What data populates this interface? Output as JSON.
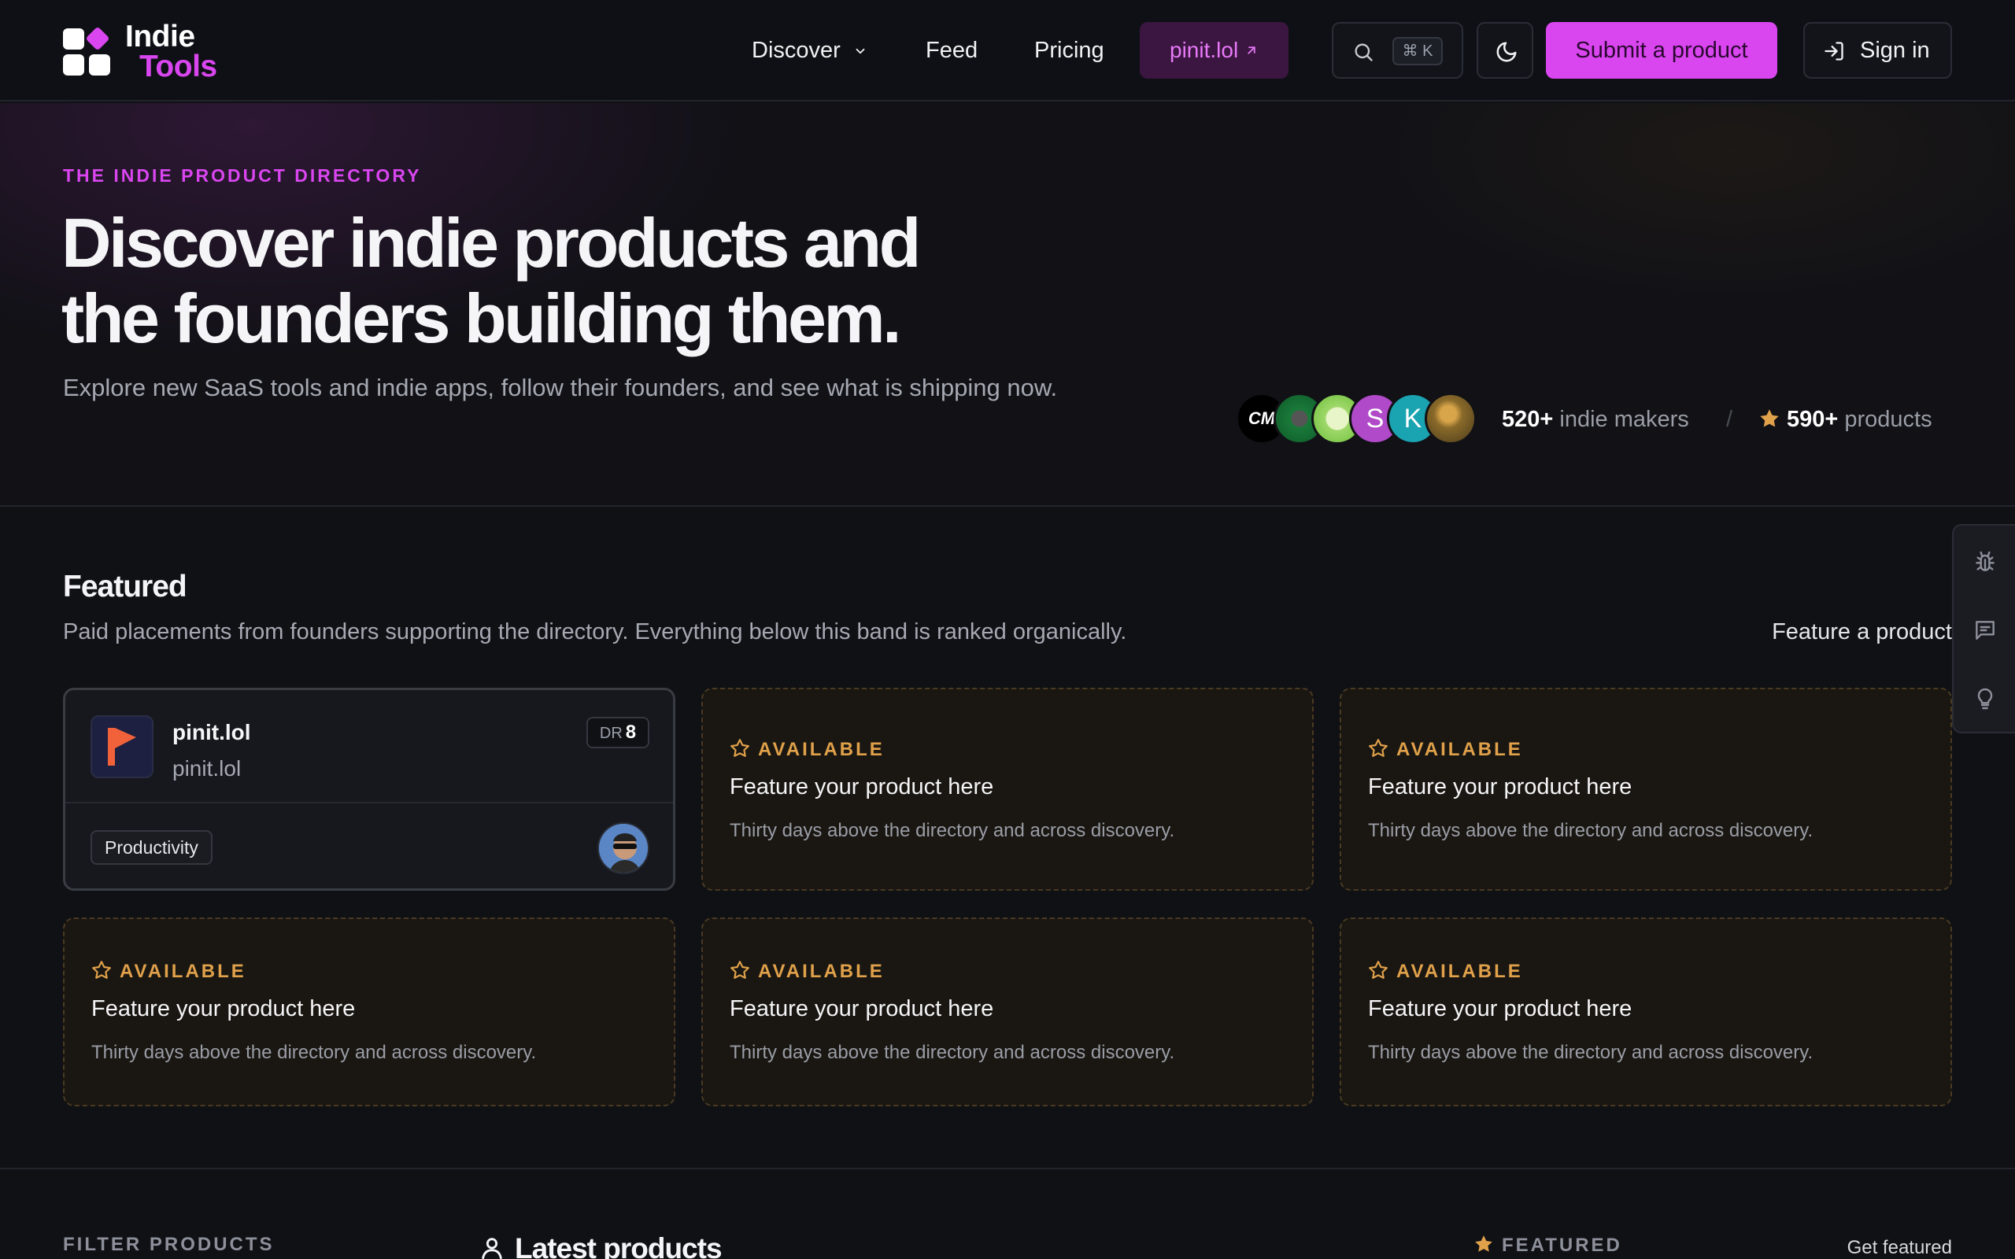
{
  "brand": {
    "line1": "Indie",
    "line2": "Tools",
    "accent": "#d946ef"
  },
  "nav": {
    "discover": "Discover",
    "feed": "Feed",
    "pricing": "Pricing",
    "pinit": "pinit.lol",
    "search_shortcut": "⌘ K",
    "submit": "Submit a product",
    "signin": "Sign in"
  },
  "hero": {
    "eyebrow": "THE INDIE PRODUCT DIRECTORY",
    "title_line1": "Discover indie products and",
    "title_line2": "the founders building them.",
    "subtitle": "Explore new SaaS tools and indie apps, follow their founders, and see what is shipping now.",
    "avatars": [
      "CM",
      "",
      "",
      "S",
      "K",
      ""
    ],
    "makers_count": "520+",
    "makers_label": "indie makers",
    "separator": "/",
    "products_count": "590+",
    "products_label": "products"
  },
  "featured": {
    "title": "Featured",
    "description": "Paid placements from founders supporting the directory. Everything below this band is ranked organically.",
    "cta": "Feature a product",
    "main_card": {
      "name": "pinit.lol",
      "url": "pinit.lol",
      "dr_label": "DR",
      "dr_value": "8",
      "tag": "Productivity"
    },
    "slot": {
      "label": "AVAILABLE",
      "title": "Feature your product here",
      "desc": "Thirty days above the directory and across discovery."
    }
  },
  "bottom": {
    "filter_label": "FILTER PRODUCTS",
    "latest_title": "Latest products",
    "featured_label": "FEATURED",
    "get_featured": "Get featured"
  }
}
